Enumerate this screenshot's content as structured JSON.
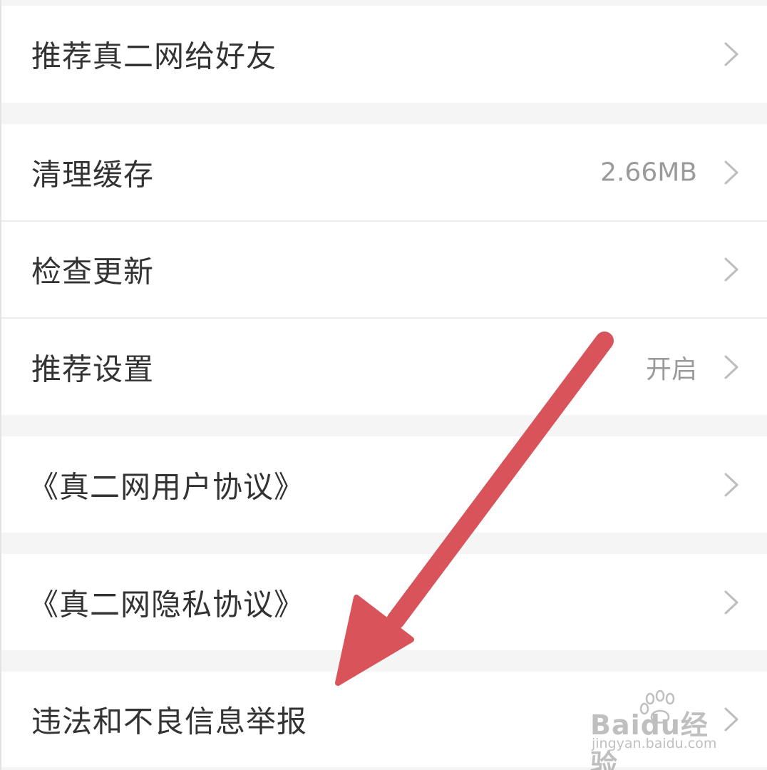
{
  "colors": {
    "page_bg": "#f5f5f5",
    "row_bg": "#ffffff",
    "label": "#333333",
    "value": "#9a9a9a",
    "chevron": "#bdbdbd",
    "arrow": "#d9535b"
  },
  "settings": {
    "recommend_friends": {
      "label": "推荐真二网给好友",
      "icon": "chevron-right-icon"
    },
    "clear_cache": {
      "label": "清理缓存",
      "value": "2.66MB",
      "icon": "chevron-right-icon"
    },
    "check_update": {
      "label": "检查更新",
      "icon": "chevron-right-icon"
    },
    "recommend_settings": {
      "label": "推荐设置",
      "value": "开启",
      "icon": "chevron-right-icon"
    },
    "user_agreement": {
      "label": "《真二网用户协议》",
      "icon": "chevron-right-icon"
    },
    "privacy_agreement": {
      "label": "《真二网隐私协议》",
      "icon": "chevron-right-icon"
    },
    "report": {
      "label": "违法和不良信息举报",
      "icon": "chevron-right-icon"
    }
  },
  "annotation": {
    "icon": "arrow-annotation"
  },
  "watermark": {
    "brand": "Baidu经验",
    "url": "jingyan.baidu.com",
    "icon": "paw-icon"
  }
}
